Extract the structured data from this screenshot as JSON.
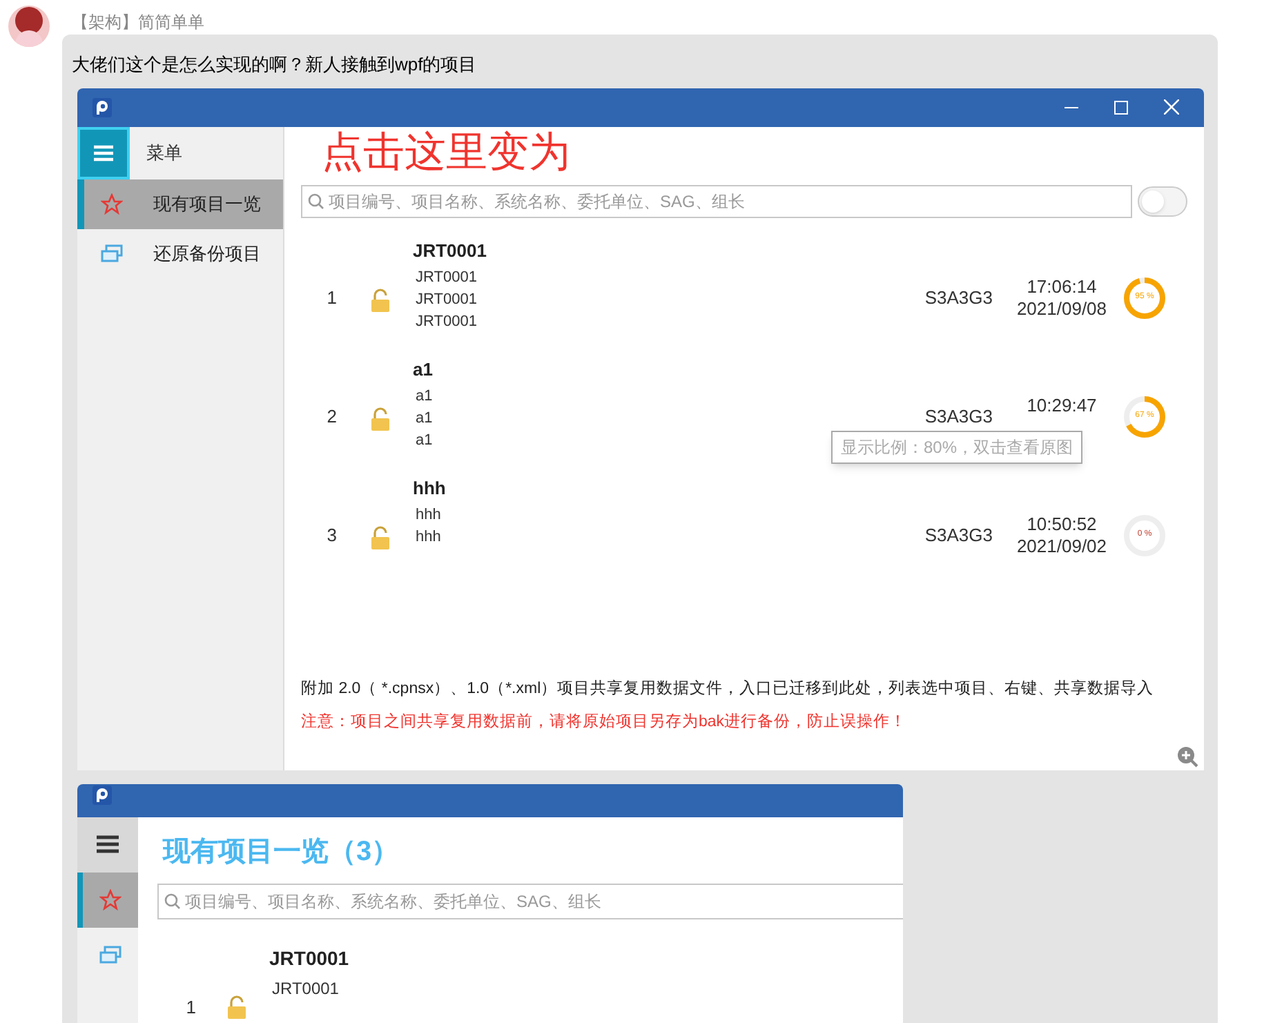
{
  "sender": "【架构】简简单单",
  "message": "大佬们这个是怎么实现的啊？新人接触到wpf的项目",
  "screenshot_1": {
    "menu_label": "菜单",
    "sidebar": [
      {
        "label": "现有项目一览",
        "kind": "star",
        "selected": true
      },
      {
        "label": "还原备份项目",
        "kind": "stack",
        "selected": false
      }
    ],
    "annotation": "点击这里变为",
    "search": {
      "placeholder": "项目编号、项目名称、系统名称、委托单位、SAG、组长"
    },
    "toggle": {
      "on": false
    },
    "rows": [
      {
        "index": "1",
        "name": "JRT0001",
        "lines": [
          "JRT0001",
          "JRT0001",
          "JRT0001"
        ],
        "code": "S3A3G3",
        "time": "17:06:14",
        "date": "2021/09/08",
        "level": 0.95,
        "percent": "95 %"
      },
      {
        "index": "2",
        "name": "a1",
        "lines": [
          "a1",
          "a1",
          "a1"
        ],
        "code": "S3A3G3",
        "time": "10:29:47",
        "level": 0.67,
        "percent": "67 %",
        "tooltip": "显示比例：80%，双击查看原图"
      },
      {
        "index": "3",
        "name": "hhh",
        "lines": [
          "hhh",
          "hhh"
        ],
        "code": "S3A3G3",
        "time": "10:50:52",
        "date": "2021/09/02",
        "level": 0,
        "percent": "0 %"
      }
    ],
    "note": "附加 2.0（ *.cpnsx）、1.0（*.xml）项目共享复用数据文件，入口已迁移到此处，列表选中项目、右键、共享数据导入",
    "warning": "注意：项目之间共享复用数据前，请将原始项目另存为bak进行备份，防止误操作！"
  },
  "screenshot_2": {
    "title": "现有项目一览（3）",
    "sidebar": [
      {
        "kind": "star",
        "selected": true
      },
      {
        "kind": "stack",
        "selected": false
      }
    ],
    "search": {
      "placeholder": "项目编号、项目名称、系统名称、委托单位、SAG、组长"
    },
    "rows": [
      {
        "index": "1",
        "name": "JRT0001",
        "lines": [
          "JRT0001"
        ]
      }
    ]
  }
}
